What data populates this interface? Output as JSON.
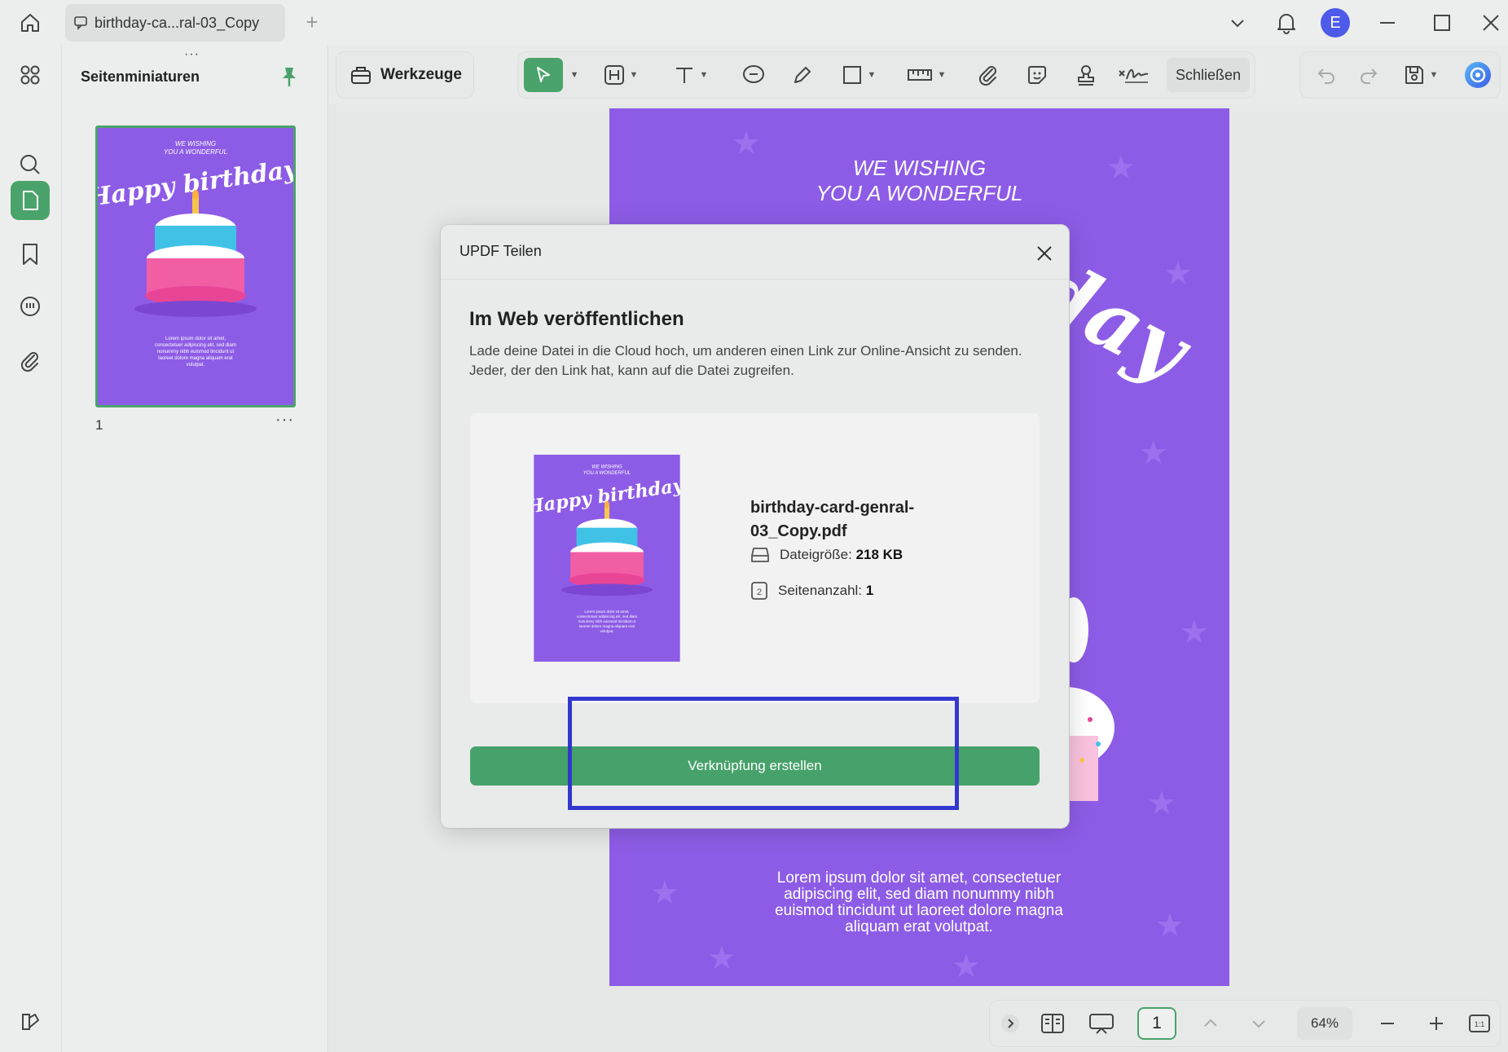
{
  "tab": {
    "title": "birthday-ca...ral-03_Copy"
  },
  "window": {
    "avatar_letter": "E"
  },
  "sidebar": {
    "title": "Seitenminiaturen",
    "page_number": "1",
    "more": "···",
    "handle": "···"
  },
  "toolbar": {
    "tools_label": "Werkzeuge",
    "close_label": "Schließen"
  },
  "page": {
    "heading_line1": "WE WISHING",
    "heading_line2": "YOU A WONDERFUL",
    "script_partial": "day",
    "thumb_script": "Happy birthday",
    "lorem": "Lorem ipsum dolor sit amet, consectetuer adipiscing elit, sed diam nonummy nibh euismod tincidunt ut laoreet dolore magna aliquam erat volutpat."
  },
  "dialog": {
    "title": "UPDF Teilen",
    "heading": "Im Web veröffentlichen",
    "description": "Lade deine Datei in die Cloud hoch, um anderen einen Link zur Online-Ansicht zu senden. Jeder, der den Link hat, kann auf die Datei zugreifen.",
    "file_name": "birthday-card-genral-03_Copy.pdf",
    "size_label": "Dateigröße:",
    "size_value": "218 KB",
    "pages_label": "Seitenanzahl:",
    "pages_value": "1",
    "button_label": "Verknüpfung erstellen"
  },
  "bottombar": {
    "page_input": "1",
    "zoom": "64%"
  },
  "colors": {
    "accent": "#4aa36b",
    "page_purple": "#8d5ce6",
    "highlight": "#3237cf"
  }
}
